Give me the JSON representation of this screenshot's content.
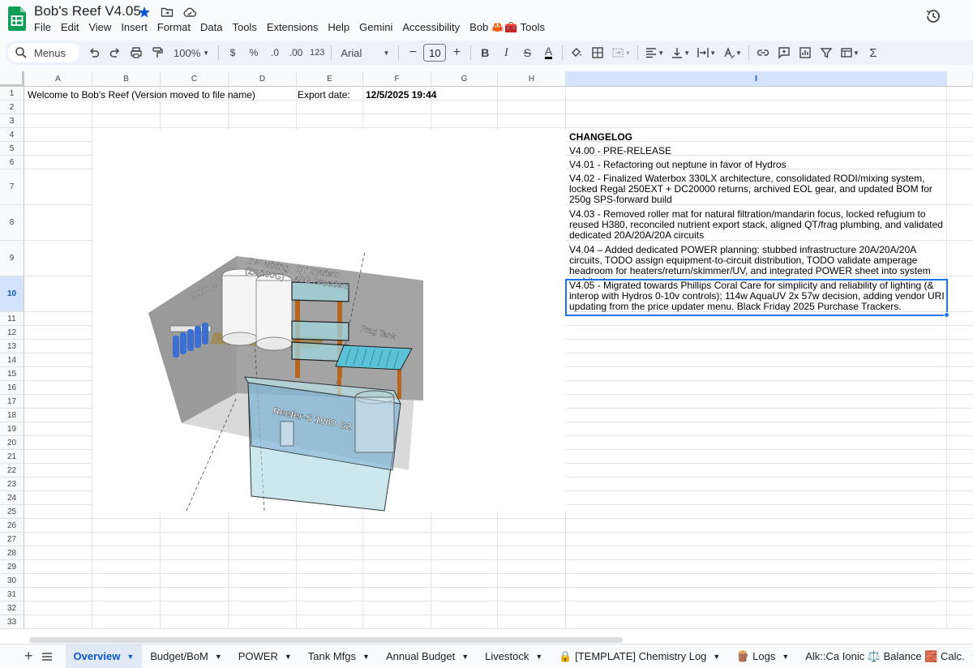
{
  "app": {
    "title": "Bob's Reef V4.05",
    "menu": [
      "File",
      "Edit",
      "View",
      "Insert",
      "Format",
      "Data",
      "Tools",
      "Extensions",
      "Help",
      "Gemini",
      "Accessibility",
      "Bob 🦀🧰 Tools"
    ]
  },
  "toolbar": {
    "search_label": "Menus",
    "zoom": "100%",
    "currency": "$",
    "percent": "%",
    "decrease_decimal": ".0",
    "increase_decimal": ".00",
    "number_format": "123",
    "font": "Arial",
    "font_size": "10",
    "bold": "B",
    "italic": "I",
    "strike": "S",
    "text_color": "A",
    "function": "Σ"
  },
  "grid": {
    "columns": [
      "A",
      "B",
      "C",
      "D",
      "E",
      "F",
      "G",
      "H",
      "I"
    ],
    "selected_column": "I",
    "rows": [
      "1",
      "2",
      "3",
      "4",
      "5",
      "6",
      "7",
      "8",
      "9",
      "10",
      "11",
      "12",
      "13",
      "14",
      "15",
      "16",
      "17",
      "18",
      "19",
      "20",
      "21",
      "22",
      "23",
      "24",
      "25",
      "26",
      "27",
      "28",
      "29",
      "30",
      "31",
      "32",
      "33"
    ],
    "selected_row": "10"
  },
  "cells": {
    "A1": "Welcome to Bob's Reef (Version moved to file name)",
    "E1": "Export date:",
    "F1": "12/5/2025 19:44",
    "I4": "CHANGELOG",
    "I5": "V4.00 - PRE-RELEASE",
    "I6": "V4.01 - Refactoring out neptune in favor of Hydros",
    "I7": "V4.02 - Finalized Waterbox 330LX architecture, consolidated RODI/mixing system, locked Regal 250EXT + DC20000 returns, archived EOL gear, and updated BOM for 250g SPS-forward build",
    "I8": "V4.03 - Removed roller mat for natural filtration/mandarin focus, locked refugium to reused H380, reconciled nutrient export stack, aligned QT/frag plumbing, and validated dedicated 20A/20A/20A circuits",
    "I9": "V4.04 – Added dedicated POWER planning: stubbed infrastructure 20A/20A/20A circuits, TODO assign equipment-to-circuit distribution, TODO validate amperage headroom for heaters/return/skimmer/UV, and integrated POWER sheet into system architecture.",
    "I10": "V4.05 - Migrated towards Phillips Coral Care for simplicity and reliability of lighting (& interop with Hydros 0-10v controls); 114w AquaUV 2x 57w decision, adding vendor URI updating from the price updater menu. Black Friday 2025 Purchase Trackers."
  },
  "image": {
    "labels": {
      "mixing": "SW Mixing\n(2x 100G)",
      "qt": "QT System\n40G Breeders",
      "frag": "Frag Tank",
      "rodi": "RO/DI + Booster",
      "sump": "Reefer-S 1000 G2"
    },
    "colors": {
      "glass": "#9fd6df",
      "wood": "#b5651d",
      "filter": "#3b6fd1",
      "floor": "#d9d9d9",
      "wall": "#9a9a9a"
    }
  },
  "tabs": [
    {
      "label": "Overview",
      "active": true
    },
    {
      "label": "Budget/BoM"
    },
    {
      "label": "POWER"
    },
    {
      "label": "Tank Mfgs"
    },
    {
      "label": "Annual Budget"
    },
    {
      "label": "Livestock"
    },
    {
      "label": "🔒 [TEMPLATE] Chemistry Log"
    },
    {
      "label": "🪵 Logs"
    },
    {
      "label": "Alk::Ca Ionic ⚖️ Balance 🧱 Calc."
    }
  ],
  "colors": {
    "accent": "#0b57d0",
    "selection": "#1a73e8",
    "sheets_green": "#0f9d58"
  }
}
